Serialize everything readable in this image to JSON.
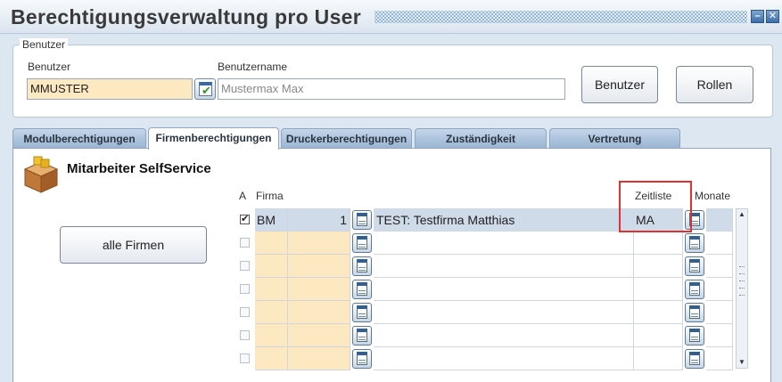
{
  "window": {
    "title": "Berechtigungsverwaltung pro User",
    "minimize_label": "–",
    "close_label": "✕"
  },
  "user_group": {
    "legend": "Benutzer",
    "user_label": "Benutzer",
    "user_value": "MMUSTER",
    "username_label": "Benutzername",
    "username_value": "Mustermax Max",
    "benutzer_button": "Benutzer",
    "rollen_button": "Rollen"
  },
  "tabs": [
    {
      "label": "Modulberechtigungen",
      "active": false
    },
    {
      "label": "Firmenberechtigungen",
      "active": true
    },
    {
      "label": "Druckerberechtigungen",
      "active": false
    },
    {
      "label": "Zuständigkeit",
      "active": false
    },
    {
      "label": "Vertretung",
      "active": false
    }
  ],
  "section": {
    "title": "Mitarbeiter SelfService",
    "alle_firmen_button": "alle Firmen"
  },
  "table": {
    "headers": {
      "a": "A",
      "firma": "Firma",
      "zeitliste": "Zeitliste",
      "monate": "Monate"
    },
    "rows": [
      {
        "checked": true,
        "check_mark": "✔",
        "firma": "BM",
        "nummer": "1",
        "name": "TEST: Testfirma Matthias",
        "zeitliste": "MA",
        "monate": ""
      },
      {
        "checked": false,
        "check_mark": "",
        "firma": "",
        "nummer": "",
        "name": "",
        "zeitliste": "",
        "monate": ""
      },
      {
        "checked": false,
        "check_mark": "",
        "firma": "",
        "nummer": "",
        "name": "",
        "zeitliste": "",
        "monate": ""
      },
      {
        "checked": false,
        "check_mark": "",
        "firma": "",
        "nummer": "",
        "name": "",
        "zeitliste": "",
        "monate": ""
      },
      {
        "checked": false,
        "check_mark": "",
        "firma": "",
        "nummer": "",
        "name": "",
        "zeitliste": "",
        "monate": ""
      },
      {
        "checked": false,
        "check_mark": "",
        "firma": "",
        "nummer": "",
        "name": "",
        "zeitliste": "",
        "monate": ""
      },
      {
        "checked": false,
        "check_mark": "",
        "firma": "",
        "nummer": "",
        "name": "",
        "zeitliste": "",
        "monate": ""
      }
    ]
  },
  "scrollbar": {
    "up_label": "▲",
    "down_label": "▼"
  },
  "colors": {
    "accent": "#3d6a9e",
    "input_yellow": "#fde9c1",
    "highlight": "#e03030",
    "selected_row": "#cfdbe8"
  }
}
